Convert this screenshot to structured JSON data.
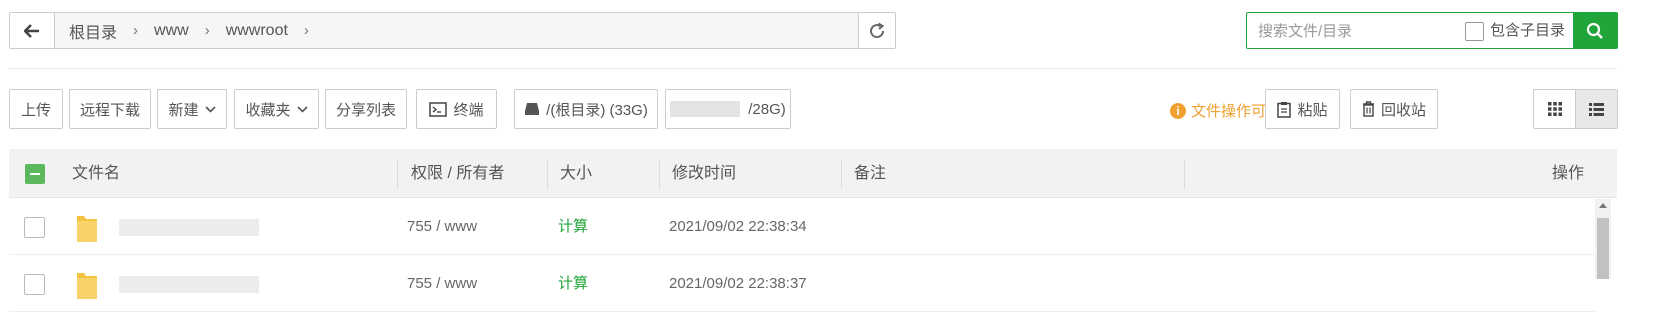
{
  "breadcrumb": {
    "items": [
      "根目录",
      "www",
      "wwwroot"
    ],
    "separator": "›"
  },
  "search": {
    "placeholder": "搜索文件/目录",
    "include_sub_label": "包含子目录",
    "include_sub_checked": false
  },
  "toolbar": {
    "upload": "上传",
    "remote_download": "远程下载",
    "new": "新建",
    "favorites": "收藏夹",
    "share_list": "分享列表",
    "terminal": "终端",
    "disk_root": "/(根目录) (33G)",
    "disk_2": "/28G)",
    "tip": "文件操作可使用右键",
    "paste": "粘贴",
    "recycle": "回收站"
  },
  "table": {
    "headers": {
      "name": "文件名",
      "perm": "权限 / 所有者",
      "size": "大小",
      "mtime": "修改时间",
      "note": "备注",
      "ops": "操作"
    },
    "rows": [
      {
        "name": "",
        "perm": "755 / www",
        "size": "计算",
        "mtime": "2021/09/02 22:38:34",
        "note": ""
      },
      {
        "name": "",
        "perm": "755 / www",
        "size": "计算",
        "mtime": "2021/09/02 22:38:37",
        "note": ""
      }
    ]
  },
  "colors": {
    "accent": "#20a53a",
    "tip": "#f0a030",
    "folder": "#f5c242"
  }
}
